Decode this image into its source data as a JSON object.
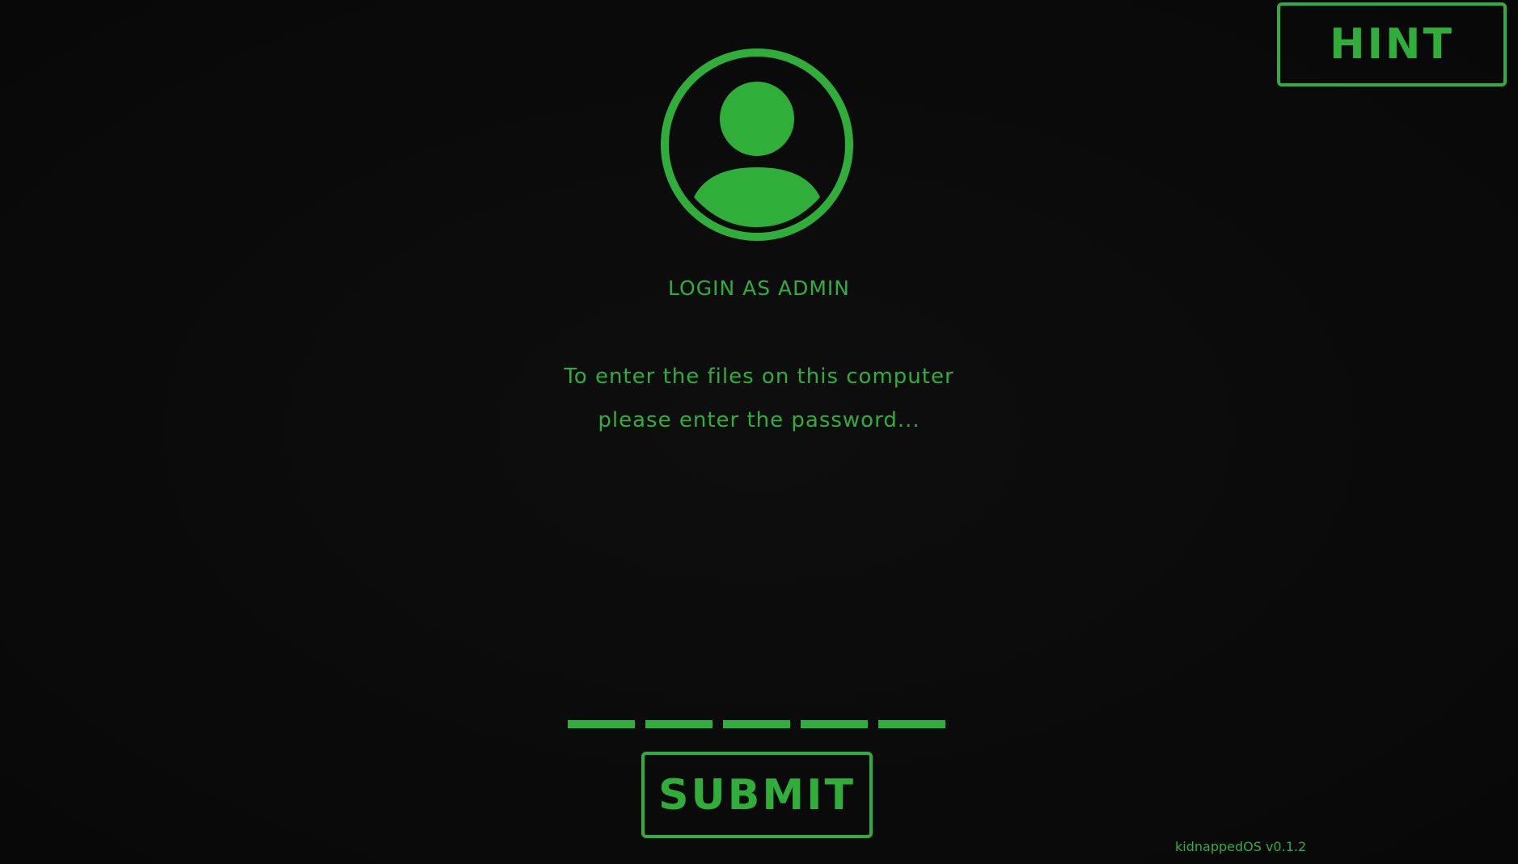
{
  "hint_button": {
    "label": "HINT"
  },
  "avatar": {
    "icon": "user-avatar-icon"
  },
  "login": {
    "title": "LOGIN AS ADMIN",
    "instruction_line1": "To enter the files on this computer",
    "instruction_line2": "please enter the password..."
  },
  "password": {
    "slot_count": 5
  },
  "submit_button": {
    "label": "SUBMIT"
  },
  "footer": {
    "version": "kidnappedOS v0.1.2"
  },
  "colors": {
    "accent": "#2fae3a",
    "background": "#0a0a0a"
  }
}
